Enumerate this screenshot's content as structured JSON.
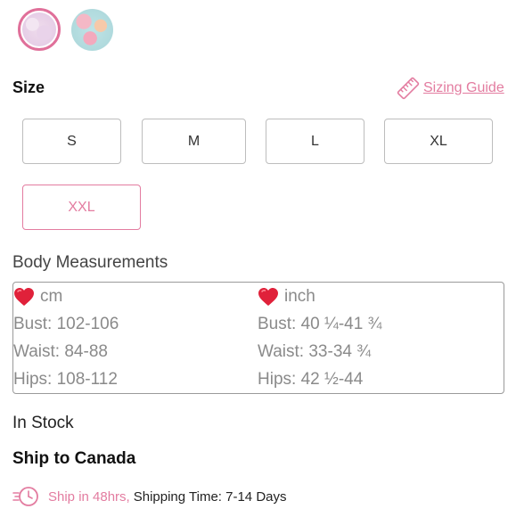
{
  "colors": {
    "accent": "#e37ca0",
    "border": "#bdbdbd",
    "muted_text": "#8a8a8a",
    "heart": "#e0213a"
  },
  "swatches": [
    {
      "name": "pastel-lilac",
      "selected": true
    },
    {
      "name": "floral-mint",
      "selected": false
    }
  ],
  "size": {
    "title": "Size",
    "guide_label": "Sizing Guide",
    "guide_icon": "ruler-icon",
    "options": [
      "S",
      "M",
      "L",
      "XL",
      "XXL"
    ],
    "selected": "XXL"
  },
  "measurements": {
    "title": "Body Measurements",
    "unit_icon": "heart-icon",
    "cm": {
      "unit": "cm",
      "bust": "Bust: 102-106",
      "waist": "Waist: 84-88",
      "hips": "Hips: 108-112"
    },
    "inch": {
      "unit": "inch",
      "bust": "Bust: 40 ¼-41 ¾",
      "waist": "Waist: 33-34 ¾",
      "hips": "Hips: 42 ½-44"
    }
  },
  "stock_status": "In Stock",
  "ship_to": "Ship to Canada",
  "shipping": {
    "icon": "clock-icon",
    "fast_label": "Ship in 48hrs,",
    "time_label": "Shipping Time: 7-14 Days"
  }
}
